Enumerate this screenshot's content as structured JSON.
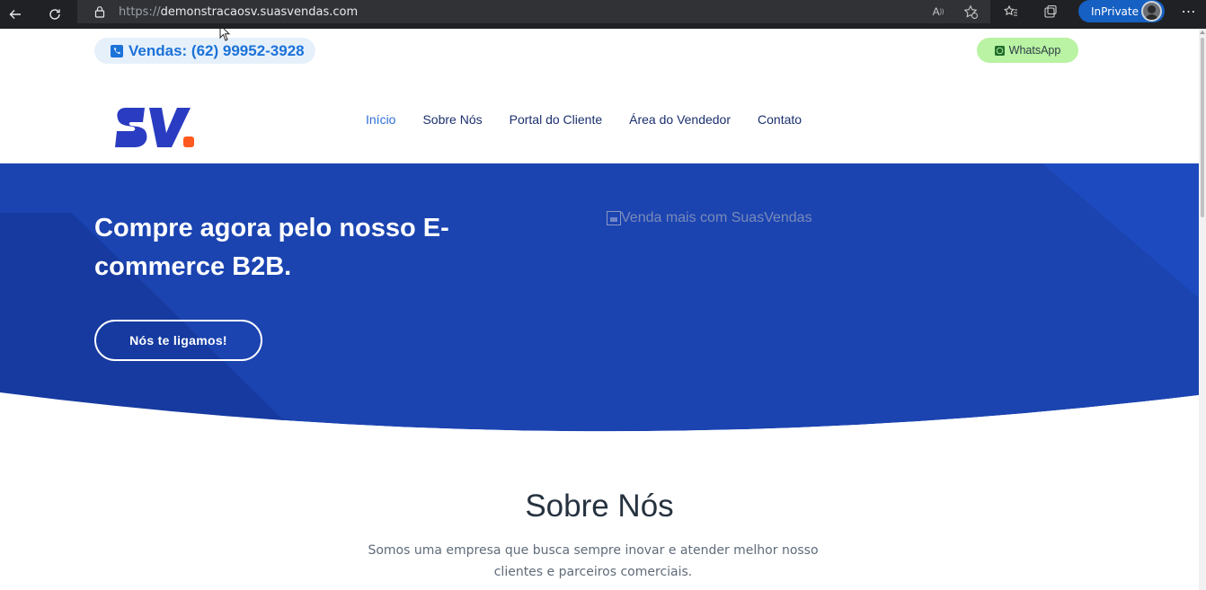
{
  "browser": {
    "url_scheme": "https://",
    "url_host": "demonstracaosv.suasvendas.com",
    "inprivate_label": "InPrivate"
  },
  "topbar": {
    "phone_label": "Vendas: (62) 99952-3928",
    "whatsapp_label": "WhatsApp"
  },
  "colors": {
    "brand_blue": "#2a3cc1",
    "brand_orange": "#ff5a1f",
    "hero_blue": "#1b44b1",
    "link_active": "#2e6fd6"
  },
  "nav": {
    "items": [
      {
        "label": "Início",
        "active": true
      },
      {
        "label": "Sobre Nós",
        "active": false
      },
      {
        "label": "Portal do Cliente",
        "active": false
      },
      {
        "label": "Área do Vendedor",
        "active": false
      },
      {
        "label": "Contato",
        "active": false
      }
    ]
  },
  "hero": {
    "title": "Compre agora pelo nosso E-commerce B2B.",
    "cta_label": "Nós te ligamos!",
    "image_alt": "Venda mais com SuasVendas"
  },
  "about": {
    "title": "Sobre Nós",
    "text": "Somos uma empresa que busca sempre inovar e atender melhor nosso clientes e parceiros comerciais."
  }
}
